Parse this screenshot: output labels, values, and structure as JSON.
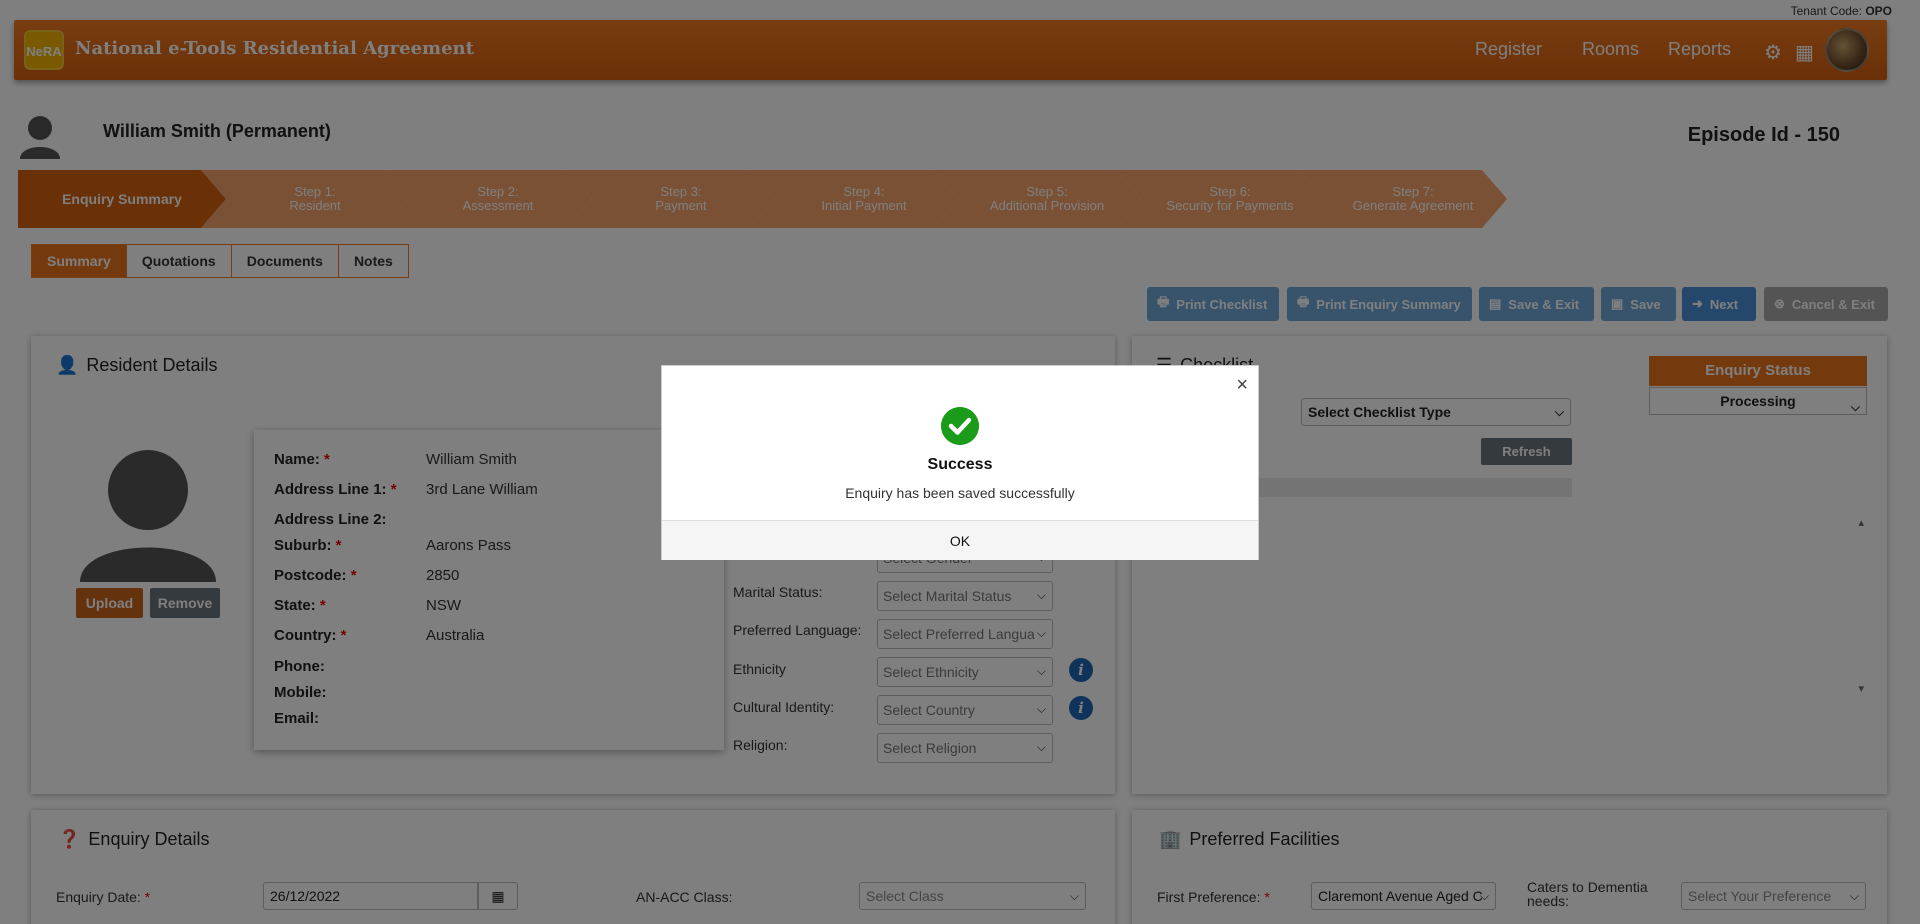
{
  "tenant": {
    "label": "Tenant Code:",
    "code": "OPO"
  },
  "header": {
    "logo_text": "NeRA",
    "title": "National e-Tools Residential Agreement",
    "nav": [
      "Register",
      "Rooms",
      "Reports"
    ]
  },
  "patient": {
    "name": "William Smith (Permanent)",
    "episode": "Episode Id - 150"
  },
  "steps": [
    {
      "line1": "Enquiry Summary",
      "line2": ""
    },
    {
      "line1": "Step 1:",
      "line2": "Resident"
    },
    {
      "line1": "Step 2:",
      "line2": "Assessment"
    },
    {
      "line1": "Step 3:",
      "line2": "Payment"
    },
    {
      "line1": "Step 4:",
      "line2": "Initial Payment"
    },
    {
      "line1": "Step 5:",
      "line2": "Additional Provision"
    },
    {
      "line1": "Step 6:",
      "line2": "Security for Payments"
    },
    {
      "line1": "Step 7:",
      "line2": "Generate Agreement"
    }
  ],
  "tabs": [
    "Summary",
    "Quotations",
    "Documents",
    "Notes"
  ],
  "actions": {
    "print_checklist": "Print Checklist",
    "print_enquiry": "Print Enquiry Summary",
    "save_exit": "Save & Exit",
    "save": "Save",
    "next": "Next",
    "cancel_exit": "Cancel & Exit"
  },
  "resident": {
    "title": "Resident Details",
    "upload": "Upload",
    "remove": "Remove",
    "fields": [
      {
        "label": "Name:",
        "required": "*",
        "value": "William Smith"
      },
      {
        "label": "Address Line 1:",
        "required": "*",
        "value": "3rd Lane William"
      },
      {
        "label": "Address Line 2:",
        "required": "",
        "value": ""
      },
      {
        "label": "Suburb:",
        "required": "*",
        "value": "Aarons Pass"
      },
      {
        "label": "Postcode:",
        "required": "*",
        "value": "2850"
      },
      {
        "label": "State:",
        "required": "*",
        "value": "NSW"
      },
      {
        "label": "Country:",
        "required": "*",
        "value": "Australia"
      },
      {
        "label": "Phone:",
        "required": "",
        "value": ""
      },
      {
        "label": "Mobile:",
        "required": "",
        "value": ""
      },
      {
        "label": "Email:",
        "required": "",
        "value": ""
      }
    ],
    "extra": [
      {
        "label": "",
        "value": "Select Gender"
      },
      {
        "label": "Marital Status:",
        "value": "Select Marital Status"
      },
      {
        "label": "Preferred Language:",
        "value": "Select Preferred Langua"
      },
      {
        "label": "Ethnicity",
        "value": "Select Ethnicity"
      },
      {
        "label": "Cultural Identity:",
        "value": "Select Country"
      },
      {
        "label": "Religion:",
        "value": "Select Religion"
      }
    ]
  },
  "checklist": {
    "title": "Checklist",
    "type_placeholder": "Select Checklist Type",
    "refresh": "Refresh",
    "status_title": "Enquiry Status",
    "status_value": "Processing"
  },
  "enquiry": {
    "title": "Enquiry Details",
    "date_label": "Enquiry Date:",
    "date_value": "26/12/2022",
    "class_label": "AN-ACC Class:",
    "class_placeholder": "Select Class"
  },
  "facilities": {
    "title": "Preferred Facilities",
    "first_label": "First Preference:",
    "first_value": "Claremont Avenue Aged C",
    "dementia_label1": "Caters to Dementia",
    "dementia_label2": "needs:",
    "dementia_placeholder": "Select Your Preference"
  },
  "modal": {
    "close": "×",
    "title": "Success",
    "message": "Enquiry has been saved successfully",
    "ok": "OK"
  }
}
